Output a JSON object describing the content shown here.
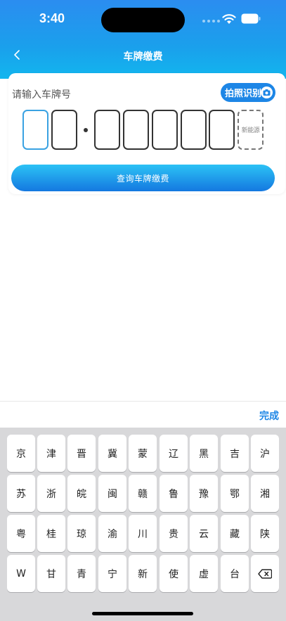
{
  "status_bar": {
    "time": "3:40"
  },
  "nav": {
    "title": "车牌缴费"
  },
  "card": {
    "label": "请输入车牌号",
    "ocr_button": "拍照识别",
    "new_energy": "新能源",
    "query_button": "查询车牌缴费"
  },
  "keyboard": {
    "done": "完成",
    "rows": [
      [
        "京",
        "津",
        "晋",
        "冀",
        "蒙",
        "辽",
        "黑",
        "吉",
        "沪"
      ],
      [
        "苏",
        "浙",
        "皖",
        "闽",
        "赣",
        "鲁",
        "豫",
        "鄂",
        "湘"
      ],
      [
        "粤",
        "桂",
        "琼",
        "渝",
        "川",
        "贵",
        "云",
        "藏",
        "陕"
      ],
      [
        "W",
        "甘",
        "青",
        "宁",
        "新",
        "使",
        "虚",
        "台"
      ]
    ],
    "delete_icon": "backspace-icon"
  },
  "colors": {
    "accent": "#1d86e6",
    "header_top": "#2b8df0",
    "header_bottom": "#12b6ee",
    "active_border": "#3aa2e2"
  }
}
